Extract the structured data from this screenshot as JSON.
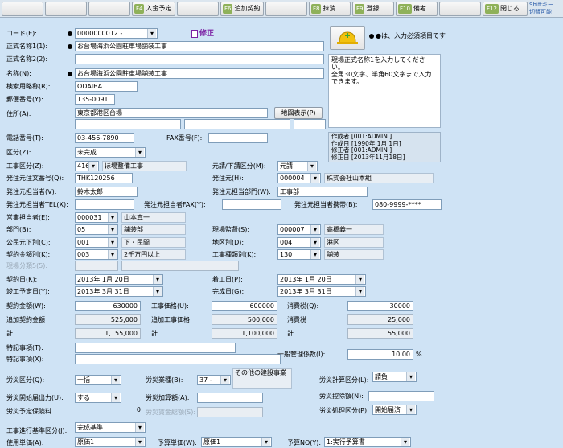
{
  "toolbar": {
    "buttons": [
      {
        "key": "",
        "label": ""
      },
      {
        "key": "",
        "label": ""
      },
      {
        "key": "",
        "label": ""
      },
      {
        "key": "F4",
        "label": "入金予定"
      },
      {
        "key": "",
        "label": ""
      },
      {
        "key": "F6",
        "label": "追加契約"
      },
      {
        "key": "",
        "label": ""
      },
      {
        "key": "F8",
        "label": "抹消"
      },
      {
        "key": "F9",
        "label": "登録"
      },
      {
        "key": "F10",
        "label": "備考"
      },
      {
        "key": "",
        "label": ""
      },
      {
        "key": "F12",
        "label": "閉じる"
      }
    ],
    "shift_hint": "Shiftキー\n切替可能"
  },
  "mode_label": "修正",
  "required_note": "●は、入力必須項目です",
  "help_text": "現場正式名称1を入力してください。\n全角30文字、半角60文字まで入力できます。",
  "audit": {
    "created_by": "作成者 [001:ADMIN     ]",
    "created_on": "作成日 [1990年 1月 1日]",
    "updated_by": "修正者 [001:ADMIN     ]",
    "updated_on": "修正日 [2013年11月18日]"
  },
  "labels": {
    "code": "コード(E):",
    "name1": "正式名称1(1):",
    "name2": "正式名称2(2):",
    "short_name": "名称(N):",
    "search_kana": "検索用略称(R):",
    "zip": "郵便番号(Y):",
    "address": "住所(A):",
    "phone": "電話番号(T):",
    "fax": "FAX番号(F):",
    "category": "区分(Z):",
    "work_type": "工事区分(Z):",
    "prime_sub": "元請/下請区分(M):",
    "orderer_doc_no": "発注元注文番号(Q):",
    "orderer": "発注元(H):",
    "orderer_person": "発注元担当者(V):",
    "orderer_dept": "発注元担当部門(W):",
    "orderer_tel": "発注元担当者TEL(X):",
    "orderer_fax": "発注元担当者FAX(Y):",
    "orderer_mobile": "発注元担当者携帯(B):",
    "sales_person": "営業担当者(E):",
    "dept": "部門(B):",
    "site_supervisor": "現場監督(S):",
    "public_private": "公民元下別(C):",
    "region": "地区別(D):",
    "contract_amount_class": "契約金額別(K):",
    "work_kind": "工事種類別(K):",
    "site_class": "現場分類5(5):",
    "contract_date": "契約日(K):",
    "start_date": "着工日(P):",
    "due_date": "竣工予定日(Y):",
    "complete_date": "完成日(G):",
    "contract_amt": "契約金額(W):",
    "work_price": "工事価格(U):",
    "tax": "消費税(Q):",
    "add_contract_amt": "追加契約金額",
    "add_work_price": "追加工事価格",
    "add_tax": "消費税",
    "total": "計",
    "total2": "計",
    "total3": "計",
    "note1": "特記事項(T):",
    "note2": "特記事項(X):",
    "general_rate": "一般管理係数(I):",
    "percent": "%",
    "labor_class": "労災区分(Q):",
    "labor_business": "労災業種(B):",
    "labor_calc": "労災計算区分(L):",
    "labor_start_flag": "労災開始届出力(U):",
    "labor_add_rate": "労災加算額(A):",
    "labor_deduct": "労災控除額(N):",
    "labor_est_fee": "労災予定保険料",
    "labor_fee_amt": "労災賃金総額(S):",
    "labor_proc": "労災処理区分(P):",
    "progress_basis": "工事進行基準区分(J):",
    "unit_use": "使用単価(A):",
    "budget_unit": "予算単価(W):",
    "budget_no": "予算NO(Y):"
  },
  "values": {
    "code": "0000000012      -",
    "name1": "お台場海浜公園駐車場舗装工事",
    "name2": "",
    "short_name": "お台場海浜公園駐車場舗装工事",
    "search_kana": "ODAIBA",
    "zip": "135-0091",
    "address_button": "地図表示(P)",
    "address1": "東京都港区台場",
    "address2a": "",
    "address2b": "",
    "address2c": "",
    "phone": "03-456-7890",
    "fax": "",
    "category": "未完成",
    "work_type_code": "416",
    "work_type_name": "ほ場整備工事",
    "prime_sub": "元請",
    "orderer_doc_no": "THK120256",
    "orderer_code": "000004",
    "orderer_name": "株式会社山本組",
    "orderer_person": "鈴木太郎",
    "orderer_dept": "工事部",
    "orderer_tel": "",
    "orderer_fax": "",
    "orderer_mobile": "080-9999-****",
    "sales_code": "000031",
    "sales_name": "山本真一",
    "dept_code": "05",
    "dept_name": "舗装部",
    "supervisor_code": "000007",
    "supervisor_name": "高橋義一",
    "public_private_code": "001",
    "public_private_name": "下・民間",
    "region_code": "004",
    "region_name": "港区",
    "contract_class_code": "003",
    "contract_class_name": "2千万円以上",
    "work_kind_code": "130",
    "work_kind_name": "舗装",
    "site_class": "",
    "contract_date": "2013年  1月 20日",
    "start_date": "2013年  1月 20日",
    "due_date": "2013年  3月 31日",
    "complete_date": "2013年  3月 31日",
    "contract_amt": "630000",
    "work_price": "600000",
    "tax": "30000",
    "add_contract_amt": "525,000",
    "add_work_price": "500,000",
    "add_tax": "25,000",
    "total_contract": "1,155,000",
    "total_work": "1,100,000",
    "total_tax": "55,000",
    "note1": "",
    "note2": "",
    "general_rate": "10.00",
    "labor_class": "一括",
    "labor_business_code": "37 -",
    "labor_business_name": "その他の建設事業",
    "labor_calc": "請負",
    "labor_start_flag": "する",
    "labor_add_rate": "",
    "labor_deduct": "",
    "labor_est_fee": "0",
    "labor_fee_amt": "",
    "labor_proc": "開始届済",
    "progress_basis": "完成基準",
    "unit_use": "原価1",
    "budget_unit": "原価1",
    "budget_no": "1:実行予算書"
  }
}
